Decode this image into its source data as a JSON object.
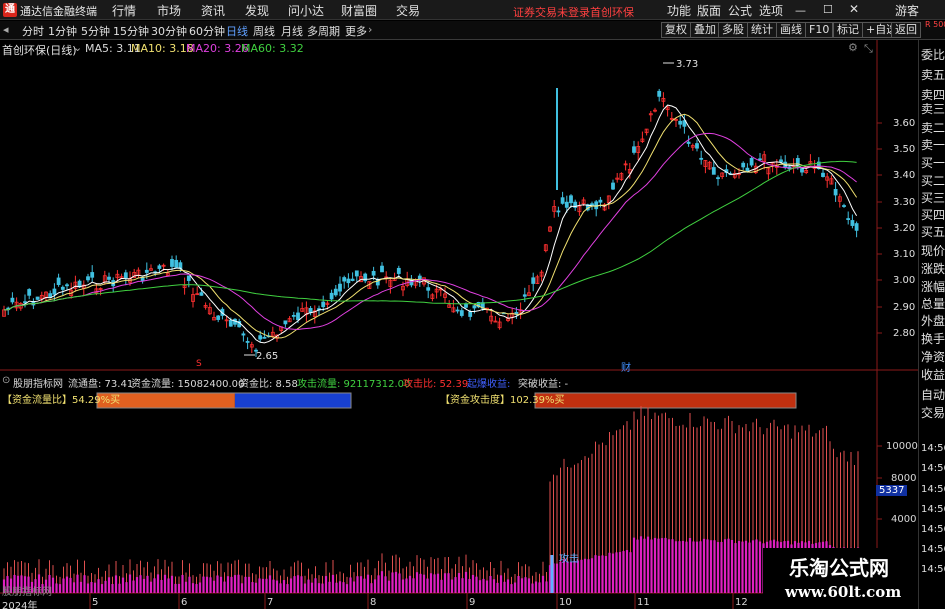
{
  "app": {
    "title": "通达信金融终端",
    "logo_char": "通"
  },
  "menu": [
    "行情",
    "市场",
    "资讯",
    "发现",
    "问小达",
    "财富圈",
    "交易"
  ],
  "notice": {
    "text": "证券交易未登录",
    "link": "首创环保"
  },
  "right_menu": [
    "功能",
    "版面",
    "公式",
    "选项"
  ],
  "guest_label": "游客",
  "window_controls": [
    "minimize",
    "maximize",
    "close"
  ],
  "toolbar": {
    "timeframes": [
      "分时",
      "1分钟",
      "5分钟",
      "15分钟",
      "30分钟",
      "60分钟",
      "日线",
      "周线",
      "月线",
      "多周期",
      "更多"
    ],
    "active_timeframe": "日线",
    "buttons": [
      "复权",
      "叠加",
      "多股",
      "统计",
      "画线",
      "F10",
      "标记",
      "+自选",
      "返回"
    ]
  },
  "header": {
    "stock_title": "首创环保(日线)",
    "ma": [
      {
        "label": "MA5: 3.11",
        "color": "#ffffff"
      },
      {
        "label": "MA10: 3.18",
        "color": "#f0e070"
      },
      {
        "label": "MA20: 3.26",
        "color": "#e040e0"
      },
      {
        "label": "MA60: 3.32",
        "color": "#40d040"
      }
    ]
  },
  "price_axis": [
    "3.60",
    "3.50",
    "3.40",
    "3.30",
    "3.20",
    "3.10",
    "3.00",
    "2.90",
    "2.80"
  ],
  "price_annotations": {
    "high": "3.73",
    "low": "2.65"
  },
  "date_markers": [
    {
      "label": "S",
      "color": "#ff3030"
    },
    {
      "label": "财",
      "color": "#4090ff"
    }
  ],
  "indicator": {
    "name": "股朋指标网",
    "items": [
      {
        "label": "流通盘: 73.41",
        "color": "#e0e0e0"
      },
      {
        "label": "资金流量: 15082400.00",
        "color": "#e0e0e0"
      },
      {
        "label": "资金比: 8.58",
        "color": "#e0e0e0"
      },
      {
        "label": "攻击流量: 92117312.00",
        "color": "#40d040"
      },
      {
        "label": "攻击比: 52.39",
        "color": "#ff3030"
      },
      {
        "label": "起爆收益:",
        "color": "#4060ff"
      },
      {
        "label": "突破收益: -",
        "color": "#e0e0e0"
      }
    ],
    "flow_ratio_label": "【资金流量比】54.29%买",
    "flow_ratio_value": 54.29,
    "attack_label": "【资金攻击度】102.39%买",
    "attack_value": 102.39,
    "attack_marker": "攻击",
    "axis": [
      "10000",
      "8000",
      "4000"
    ],
    "axis_badge": "5337"
  },
  "sidebar": [
    "委比",
    "卖五",
    "卖四",
    "卖三",
    "卖二",
    "卖一",
    "买一",
    "买二",
    "买三",
    "买四",
    "买五",
    "现价",
    "涨跌",
    "涨幅",
    "总量",
    "外盘",
    "换手",
    "净资",
    "收益",
    "自动",
    "交易"
  ],
  "sidebar_top": "R 500",
  "times": [
    "14:56",
    "14:56",
    "14:56",
    "14:56",
    "14:56",
    "14:56",
    "14:56"
  ],
  "date_axis": [
    "2024年",
    "5",
    "6",
    "7",
    "8",
    "9",
    "10",
    "11",
    "12"
  ],
  "footer_left": "股朋指标网",
  "watermark": {
    "title": "乐淘公式网",
    "url": "www.60lt.com"
  }
}
